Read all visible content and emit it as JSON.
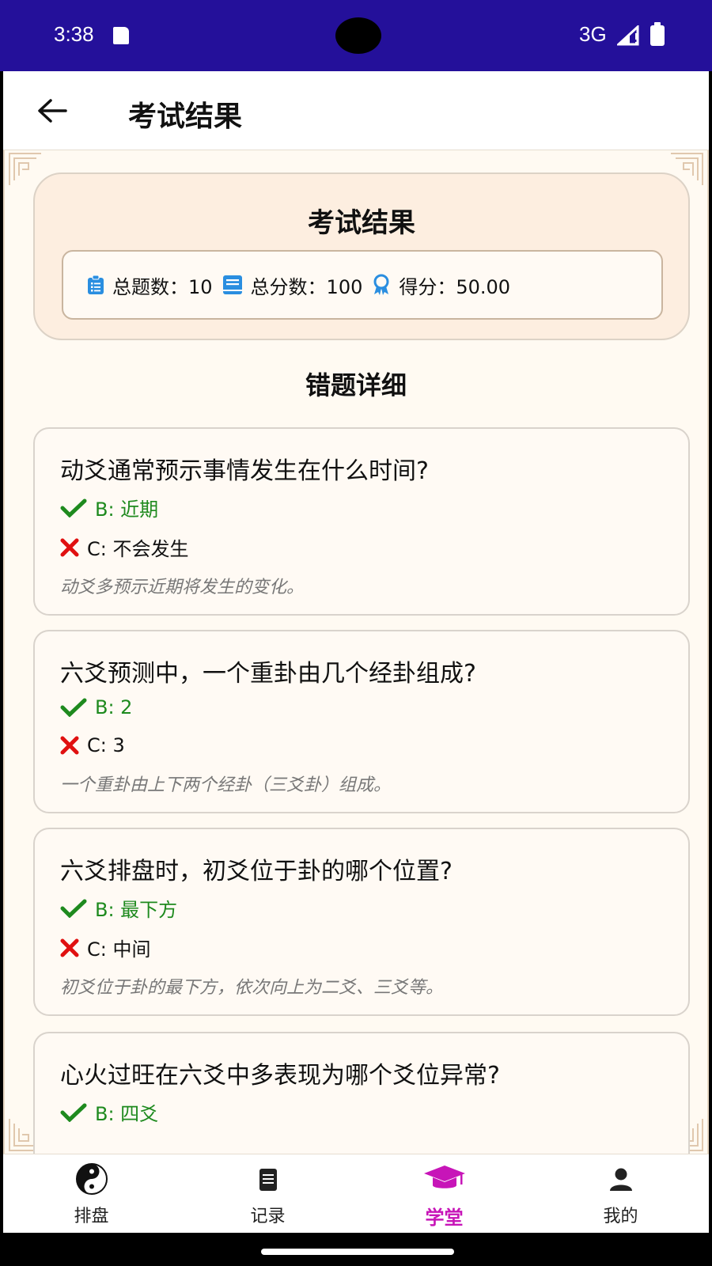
{
  "status_bar": {
    "time": "3:38",
    "network": "3G",
    "icons": [
      "sd-card-icon",
      "signal-icon",
      "battery-icon"
    ],
    "background": "#24109a"
  },
  "app_bar": {
    "title": "考试结果",
    "back_icon": "arrow-left-icon"
  },
  "summary": {
    "title": "考试结果",
    "stats": [
      {
        "icon": "clipboard-icon",
        "text": "总题数：10"
      },
      {
        "icon": "book-icon",
        "text": "总分数：100"
      },
      {
        "icon": "award-icon",
        "text": "得分：50.00"
      }
    ]
  },
  "wrong_section": {
    "heading": "错题详细"
  },
  "questions": [
    {
      "question": "动爻通常预示事情发生在什么时间?",
      "correct": "B: 近期",
      "wrong": "C: 不会发生",
      "explanation": "动爻多预示近期将发生的变化。"
    },
    {
      "question": "六爻预测中，一个重卦由几个经卦组成?",
      "correct": "B: 2",
      "wrong": "C: 3",
      "explanation": "一个重卦由上下两个经卦（三爻卦）组成。"
    },
    {
      "question": "六爻排盘时，初爻位于卦的哪个位置?",
      "correct": "B: 最下方",
      "wrong": "C: 中间",
      "explanation": "初爻位于卦的最下方，依次向上为二爻、三爻等。"
    },
    {
      "question": "心火过旺在六爻中多表现为哪个爻位异常?",
      "correct": "B: 四爻"
    }
  ],
  "bottom_nav": {
    "items": [
      {
        "label": "排盘",
        "icon": "yin-yang-icon",
        "active": false
      },
      {
        "label": "记录",
        "icon": "document-icon",
        "active": false
      },
      {
        "label": "学堂",
        "icon": "graduation-cap-icon",
        "active": true
      },
      {
        "label": "我的",
        "icon": "user-icon",
        "active": false
      }
    ],
    "active_color": "#c715b8"
  },
  "colors": {
    "correct": "#1e8a1e",
    "wrong_icon": "#e01010",
    "stat_icon": "#2a8ee0",
    "card_background": "#fdeee0"
  }
}
